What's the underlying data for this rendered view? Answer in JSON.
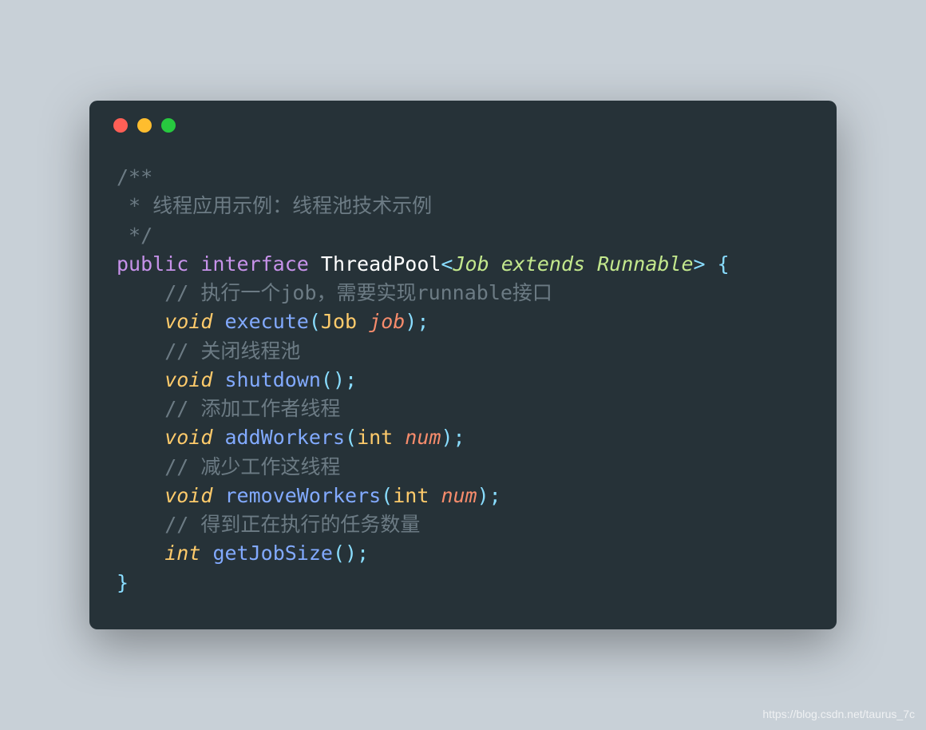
{
  "colors": {
    "bg_page": "#c8d0d7",
    "bg_window": "#263238",
    "dot_red": "#ff5f56",
    "dot_yellow": "#ffbd2e",
    "dot_green": "#27c93f",
    "comment": "#6c7b84",
    "keyword_vis": "#c792ea",
    "keyword_type": "#c3e88d",
    "keyword_void": "#ffcb6b",
    "class": "#ffffff",
    "punct": "#89ddff",
    "method": "#82aaff",
    "param_type": "#ffcb6b",
    "param_name": "#f78c6c"
  },
  "code": {
    "l1": "/**",
    "l2": " * 线程应用示例：线程池技术示例",
    "l3": " */",
    "l4_public": "public",
    "l4_interface": "interface",
    "l4_class": "ThreadPool",
    "l4_lt": "<",
    "l4_job": "Job",
    "l4_extends": "extends",
    "l4_runnable": "Runnable",
    "l4_gt": ">",
    "l4_brace": " {",
    "l5_comment": "// 执行一个job，需要实现runnable接口",
    "l6_void": "void",
    "l6_method": "execute",
    "l6_lp": "(",
    "l6_type": "Job",
    "l6_name": "job",
    "l6_rp": ");",
    "l7_comment": "// 关闭线程池",
    "l8_void": "void",
    "l8_method": "shutdown",
    "l8_paren": "();",
    "l9_comment": "// 添加工作者线程",
    "l10_void": "void",
    "l10_method": "addWorkers",
    "l10_lp": "(",
    "l10_type": "int",
    "l10_name": "num",
    "l10_rp": ");",
    "l11_comment": "// 减少工作这线程",
    "l12_void": "void",
    "l12_method": "removeWorkers",
    "l12_lp": "(",
    "l12_type": "int",
    "l12_name": "num",
    "l12_rp": ");",
    "l13_comment": "// 得到正在执行的任务数量",
    "l14_int": "int",
    "l14_method": "getJobSize",
    "l14_paren": "();",
    "l15": "}"
  },
  "watermark": "https://blog.csdn.net/taurus_7c"
}
